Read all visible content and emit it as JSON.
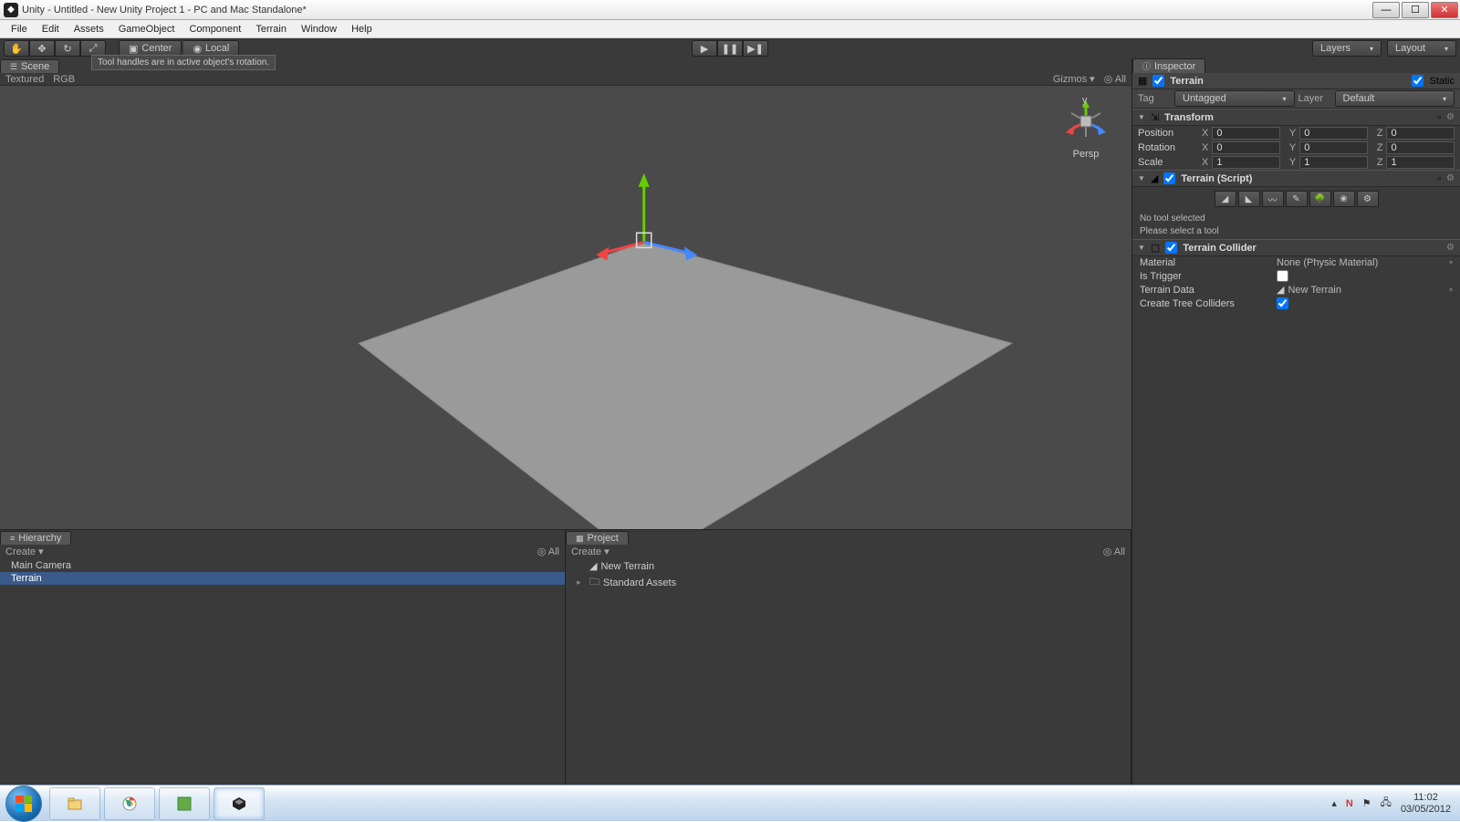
{
  "window": {
    "title": "Unity - Untitled - New Unity Project 1 - PC and Mac Standalone*"
  },
  "menu": [
    "File",
    "Edit",
    "Assets",
    "GameObject",
    "Component",
    "Terrain",
    "Window",
    "Help"
  ],
  "toolbar": {
    "pivot_center": "Center",
    "pivot_local": "Local",
    "layers": "Layers",
    "layout": "Layout",
    "tooltip": "Tool handles are in active object's rotation."
  },
  "scene": {
    "tab": "Scene",
    "shading": "Textured",
    "render": "RGB",
    "gizmos": "Gizmos",
    "search_mode": "All",
    "axis_y": "y",
    "persp": "Persp"
  },
  "hierarchy": {
    "tab": "Hierarchy",
    "create": "Create",
    "search_mode": "All",
    "items": [
      "Main Camera",
      "Terrain"
    ],
    "selected": 1
  },
  "project": {
    "tab": "Project",
    "create": "Create",
    "search_mode": "All",
    "items": [
      {
        "name": "New Terrain",
        "expandable": false
      },
      {
        "name": "Standard Assets",
        "expandable": true
      }
    ]
  },
  "inspector": {
    "tab": "Inspector",
    "object_name": "Terrain",
    "static_label": "Static",
    "tag_label": "Tag",
    "tag_value": "Untagged",
    "layer_label": "Layer",
    "layer_value": "Default",
    "transform": {
      "title": "Transform",
      "position_label": "Position",
      "rotation_label": "Rotation",
      "scale_label": "Scale",
      "pos": {
        "x": "0",
        "y": "0",
        "z": "0"
      },
      "rot": {
        "x": "0",
        "y": "0",
        "z": "0"
      },
      "scale": {
        "x": "1",
        "y": "1",
        "z": "1"
      }
    },
    "terrain_script": {
      "title": "Terrain (Script)",
      "no_tool": "No tool selected",
      "please": "Please select a tool"
    },
    "terrain_collider": {
      "title": "Terrain Collider",
      "material_label": "Material",
      "material_value": "None (Physic Material)",
      "trigger_label": "Is Trigger",
      "data_label": "Terrain Data",
      "data_value": "New Terrain",
      "tree_label": "Create Tree Colliders"
    }
  },
  "taskbar": {
    "time": "11:02",
    "date": "03/05/2012"
  }
}
